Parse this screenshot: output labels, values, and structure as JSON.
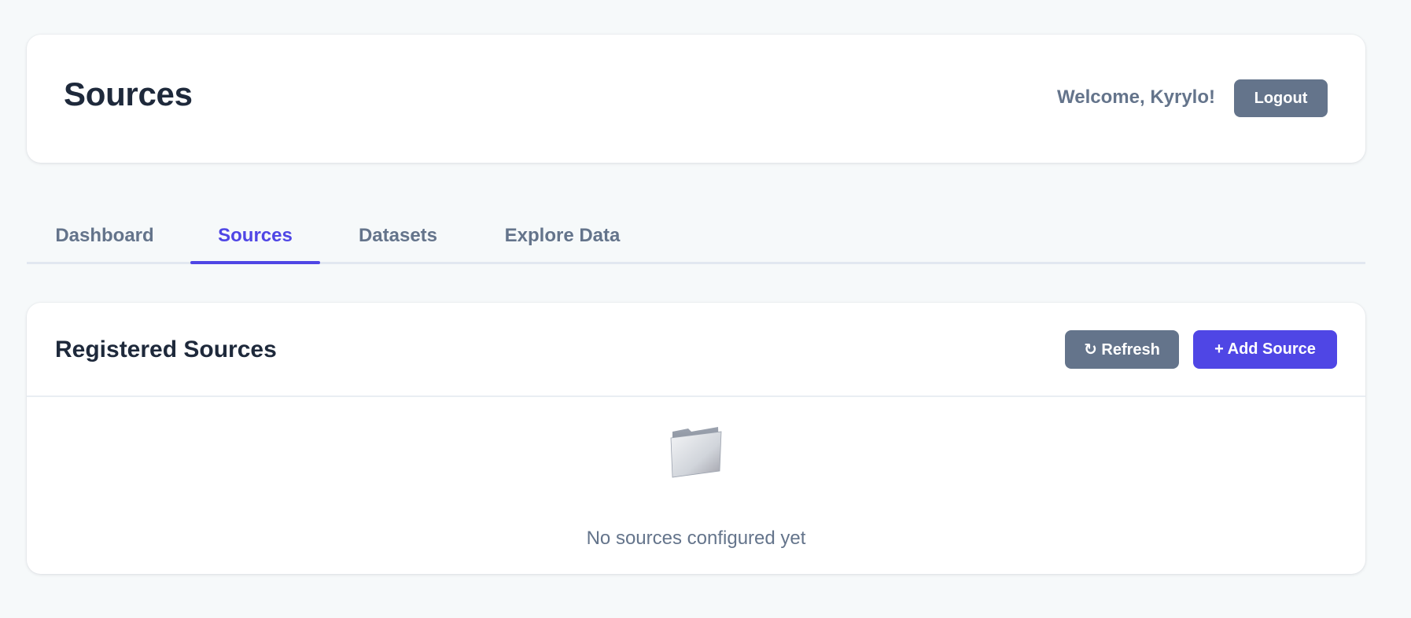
{
  "header": {
    "title": "Sources",
    "welcome": "Welcome, Kyrylo!",
    "logout_label": "Logout"
  },
  "tabs": [
    {
      "label": "Dashboard",
      "active": false
    },
    {
      "label": "Sources",
      "active": true
    },
    {
      "label": "Datasets",
      "active": false
    },
    {
      "label": "Explore Data",
      "active": false
    }
  ],
  "sources_panel": {
    "title": "Registered Sources",
    "refresh_label": "↻ Refresh",
    "add_label": "+ Add Source",
    "empty_icon": "folder-icon",
    "empty_text": "No sources configured yet"
  },
  "colors": {
    "accent": "#4f46e5",
    "muted_button": "#64748b",
    "background": "#f6f9fa",
    "text_primary": "#1e293b",
    "text_secondary": "#64748b"
  }
}
